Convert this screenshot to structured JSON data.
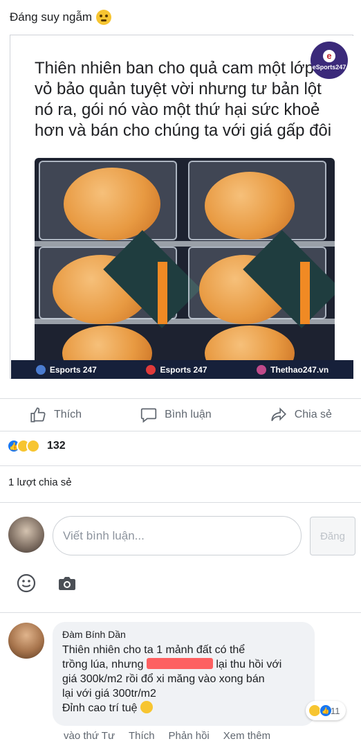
{
  "post": {
    "caption": "Đáng suy ngẫm",
    "caption_emoji": "thinking-face-emoji",
    "image": {
      "meme_text": "Thiên nhiên ban cho quả cam một lớp vỏ bảo quản tuyệt vời nhưng tư bản lột nó ra, gói nó vào một thứ hại sức khoẻ hơn và bán cho chúng ta với giá gấp đôi",
      "badge_text": "eSports247",
      "footer": [
        {
          "label": "Esports 247",
          "icon": "esports-globe-icon"
        },
        {
          "label": "Esports 247",
          "icon": "esports-logo-icon"
        },
        {
          "label": "Thethao247.vn",
          "icon": "thethao-logo-icon"
        }
      ]
    }
  },
  "actions": {
    "like": "Thích",
    "comment": "Bình luận",
    "share": "Chia sẻ"
  },
  "reactions": {
    "count": "132",
    "types": [
      "like",
      "haha",
      "sad"
    ]
  },
  "shares": "1 lượt chia sẻ",
  "composer": {
    "placeholder": "Viết bình luận...",
    "post_button": "Đăng"
  },
  "comments": [
    {
      "author": "Đàm Bính Dần",
      "line1": "Thiên nhiên cho ta 1 mảnh đất có thể",
      "line2_before": "trồng lúa, nhưng",
      "line2_after": "lại thu hồi với",
      "line3": "giá 300k/m2 rồi đổ xi măng vào xong bán",
      "line4": "lại với giá 300tr/m2",
      "line5": "Đỉnh cao trí tuệ",
      "reaction_count": "11",
      "actions": {
        "time": "vào thứ Tư",
        "like": "Thích",
        "reply": "Phản hồi",
        "more": "Xem thêm"
      }
    }
  ],
  "colors": {
    "facebook_blue": "#1877f2",
    "muted_text": "#606770",
    "bubble_bg": "#f0f2f5",
    "footer_bg": "#16203a"
  }
}
